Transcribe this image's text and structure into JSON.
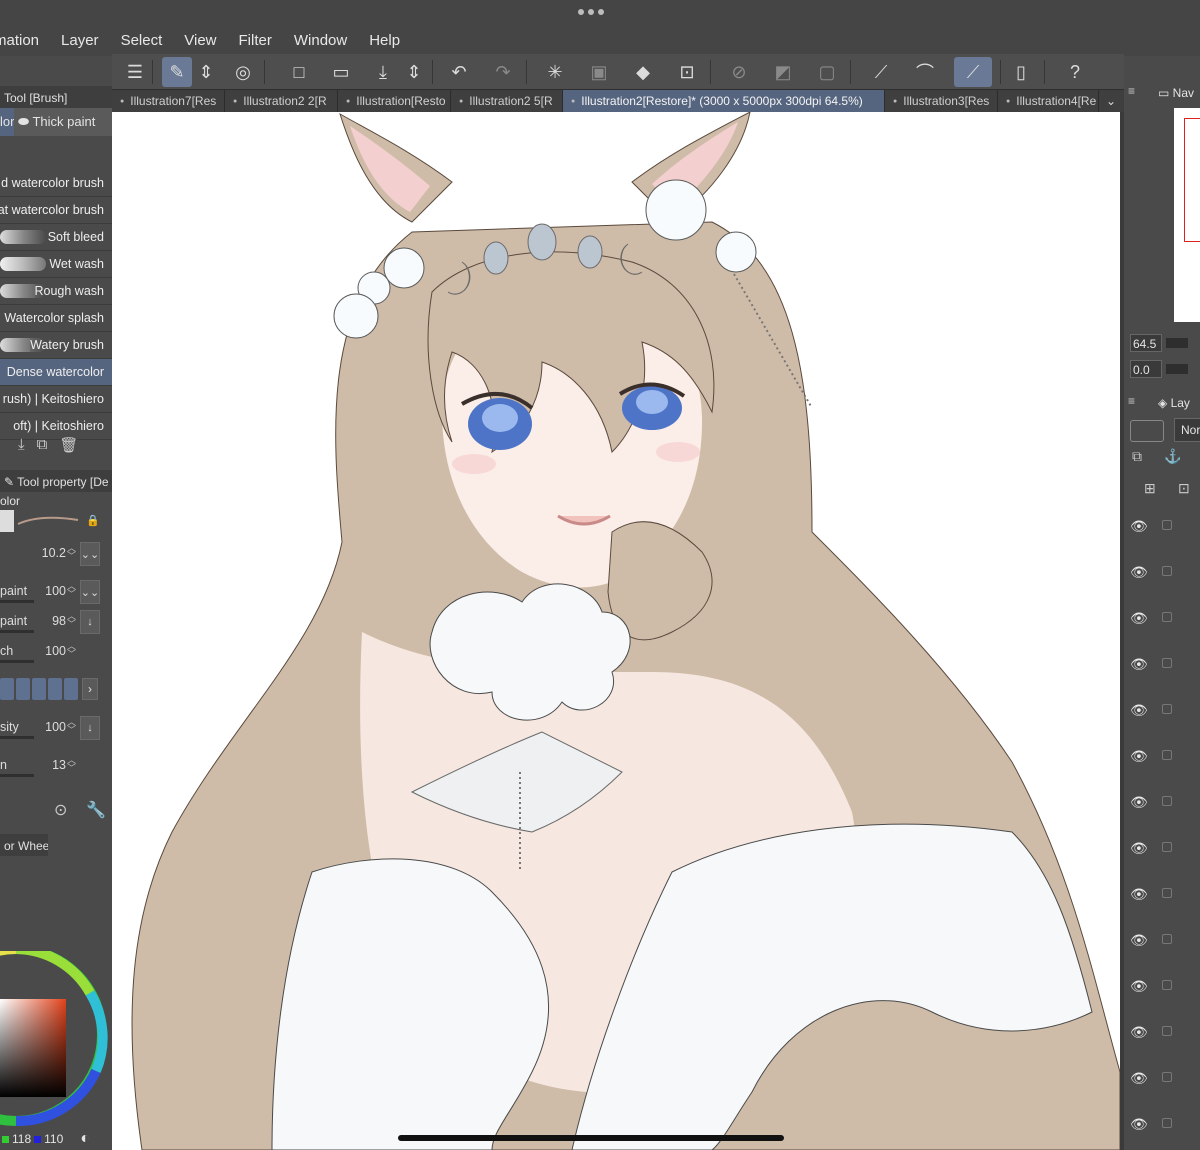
{
  "menu": [
    "mation",
    "Layer",
    "Select",
    "View",
    "Filter",
    "Window",
    "Help"
  ],
  "toolbar_icons": [
    "menu-icon",
    "tool-icon",
    "updown-icon",
    "lasso-icon",
    "new-canvas-icon",
    "open-folder-icon",
    "save-icon",
    "updown-icon",
    "undo-icon",
    "redo-icon",
    "loading-icon",
    "selection-icon",
    "fill-icon",
    "transform-icon",
    "no-select-icon",
    "gradient-icon",
    "frame-icon",
    "ruler-icon",
    "brush-icon",
    "pen-active-icon",
    "device-icon",
    "help-icon"
  ],
  "tabs": [
    {
      "label": "Illustration7[Res",
      "active": false
    },
    {
      "label": "Illustration2 2[R",
      "active": false
    },
    {
      "label": "Illustration[Resto",
      "active": false
    },
    {
      "label": "Illustration2 5[R",
      "active": false
    },
    {
      "label": "Illustration2[Restore]* (3000 x 5000px 300dpi 64.5%)",
      "active": true
    },
    {
      "label": "Illustration3[Res",
      "active": false
    },
    {
      "label": "Illustration4[Re",
      "active": false
    }
  ],
  "left_panel": {
    "tool_title": "Tool [Brush]",
    "subtab_partial": "lor",
    "subtab_active": "Thick paint",
    "brushes": [
      {
        "label": "d watercolor brush",
        "selected": false
      },
      {
        "label": "at watercolor brush",
        "selected": false
      },
      {
        "label": "Soft bleed",
        "selected": false
      },
      {
        "label": "Wet wash",
        "selected": false
      },
      {
        "label": "Rough wash",
        "selected": false
      },
      {
        "label": "Watercolor splash",
        "selected": false
      },
      {
        "label": "Watery brush",
        "selected": false
      },
      {
        "label": "Dense watercolor",
        "selected": true
      },
      {
        "label": "rush) | Keitoshiero",
        "selected": false
      },
      {
        "label": "oft) | Keitoshiero",
        "selected": false
      }
    ],
    "property_title": "Tool property [De",
    "property_sub": "olor",
    "properties": [
      {
        "label": "",
        "value": "10.2",
        "btn": "⌄⌄"
      },
      {
        "label": "paint",
        "value": "100",
        "btn": "⌄⌄"
      },
      {
        "label": "paint",
        "value": "98",
        "btn": "↓"
      },
      {
        "label": "ch",
        "value": "100",
        "btn": ""
      },
      {
        "label": "sity",
        "value": "100",
        "btn": "↓"
      },
      {
        "label": "n",
        "value": "13",
        "btn": ""
      }
    ],
    "color_wheel_title": "or Wheel",
    "rgb": {
      "g": "118",
      "b": "110"
    }
  },
  "right_panel": {
    "nav_title": "Nav",
    "zoom": "64.5",
    "rotation": "0.0",
    "layer_title": "Lay",
    "blend_mode": "Nor"
  },
  "colors": {
    "accent": "#56657f",
    "hair": "#cfbca8",
    "panel": "#4a4a4a"
  }
}
